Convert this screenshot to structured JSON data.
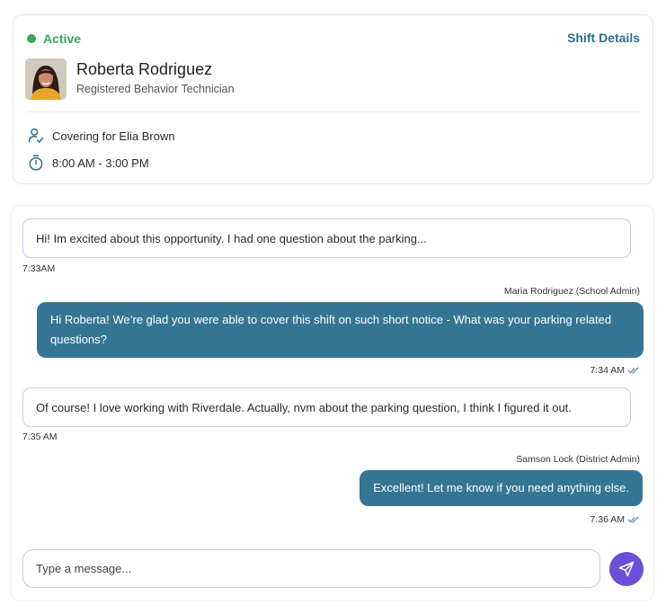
{
  "colors": {
    "active_green": "#3aa564",
    "link_teal": "#2f6f8f",
    "bubble_out": "#357594",
    "bubble_in_border": "#cfc7ea",
    "send_purple": "#6c4fd8"
  },
  "shift": {
    "status": "Active",
    "details_link": "Shift Details",
    "worker_name": "Roberta Rodriguez",
    "worker_role": "Registered Behavior Technician",
    "covering": "Covering for Elia Brown",
    "hours": "8:00 AM - 3:00 PM",
    "icons": {
      "covering": "user-check-icon",
      "hours": "stopwatch-icon"
    }
  },
  "messages": [
    {
      "direction": "in",
      "text": "Hi! Im excited about this opportunity. I had one question about the parking...",
      "time": "7:33AM"
    },
    {
      "direction": "out",
      "sender": "Maria Rodriguez (School Admin)",
      "text": "Hi Roberta! We’re glad you were able to cover this shift on such short notice - What was your parking related questions?",
      "time": "7:34 AM"
    },
    {
      "direction": "in",
      "text": "Of course! I love working with Riverdale. Actually, nvm about the parking question, I think I figured it out.",
      "time": "7:35 AM"
    },
    {
      "direction": "out",
      "sender": "Samson Lock (District Admin)",
      "text": "Excellent! Let me know if you need anything else.",
      "time": "7:36 AM"
    }
  ],
  "composer": {
    "placeholder": "Type a message...",
    "send_icon": "send-icon"
  }
}
